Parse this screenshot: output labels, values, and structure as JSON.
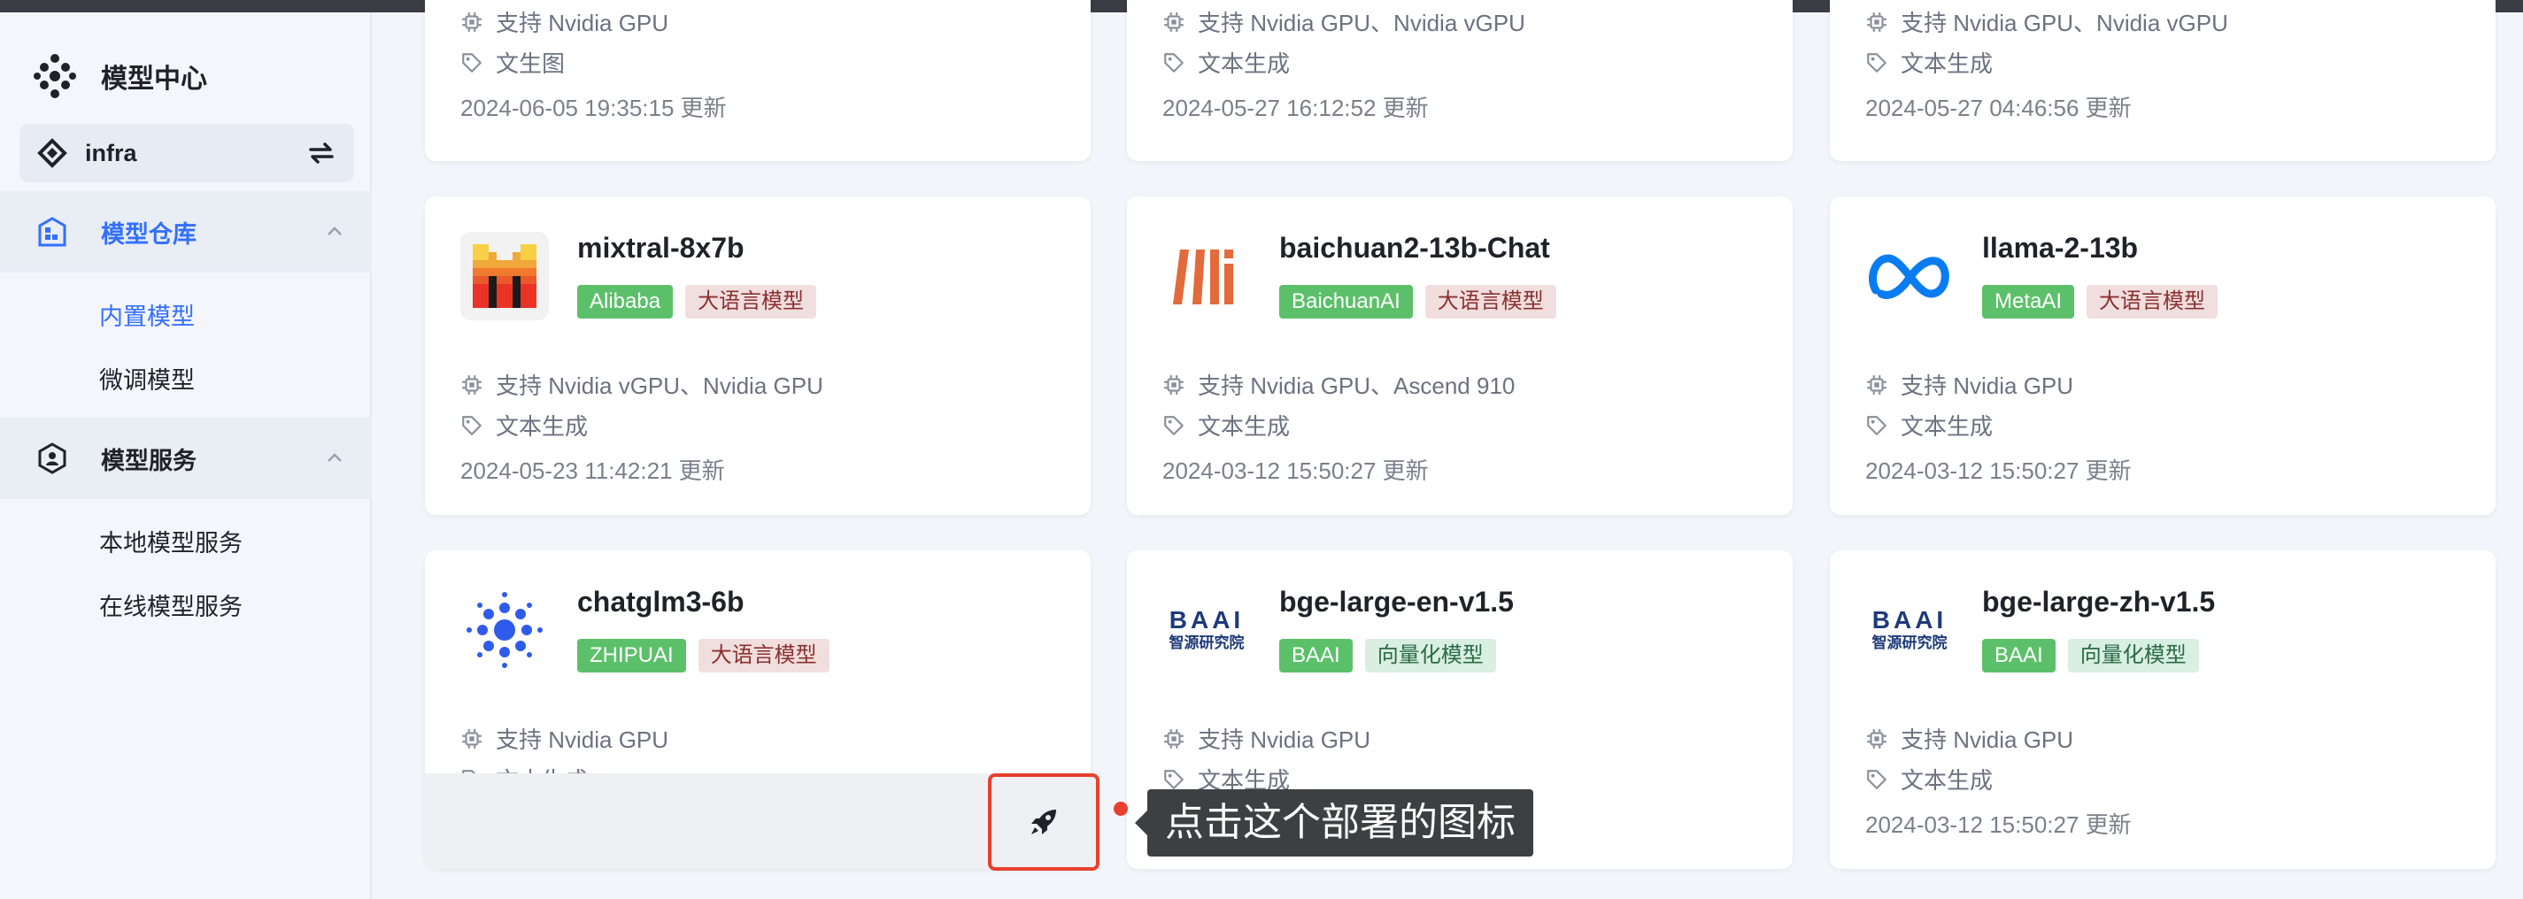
{
  "app": {
    "title": "模型中心"
  },
  "workspace": {
    "name": "infra"
  },
  "nav": {
    "repo": {
      "label": "模型仓库",
      "items": [
        "内置模型",
        "微调模型"
      ]
    },
    "service": {
      "label": "模型服务",
      "items": [
        "本地模型服务",
        "在线模型服务"
      ]
    }
  },
  "cards": [
    {
      "support": "支持 Nvidia GPU",
      "task": "文生图",
      "updated": "2024-06-05 19:35:15 更新"
    },
    {
      "support": "支持 Nvidia GPU、Nvidia vGPU",
      "task": "文本生成",
      "updated": "2024-05-27 16:12:52 更新"
    },
    {
      "support": "支持 Nvidia GPU、Nvidia vGPU",
      "task": "文本生成",
      "updated": "2024-05-27 04:46:56 更新"
    },
    {
      "name": "mixtral-8x7b",
      "vendor": "Alibaba",
      "type": "大语言模型",
      "support": "支持 Nvidia vGPU、Nvidia GPU",
      "task": "文本生成",
      "updated": "2024-05-23 11:42:21 更新",
      "logo": "mistral-logo"
    },
    {
      "name": "baichuan2-13b-Chat",
      "vendor": "BaichuanAI",
      "type": "大语言模型",
      "support": "支持 Nvidia GPU、Ascend 910",
      "task": "文本生成",
      "updated": "2024-03-12 15:50:27 更新",
      "logo": "baichuan-logo"
    },
    {
      "name": "llama-2-13b",
      "vendor": "MetaAI",
      "type": "大语言模型",
      "support": "支持 Nvidia GPU",
      "task": "文本生成",
      "updated": "2024-03-12 15:50:27 更新",
      "logo": "meta-logo"
    },
    {
      "name": "chatglm3-6b",
      "vendor": "ZHIPUAI",
      "type": "大语言模型",
      "support": "支持 Nvidia GPU",
      "task": "文本生成",
      "logo": "zhipu-logo"
    },
    {
      "name": "bge-large-en-v1.5",
      "vendor": "BAAI",
      "type": "向量化模型",
      "support": "支持 Nvidia GPU",
      "task": "文本生成",
      "logo": "baai-logo",
      "logo_text_top": "BAAI",
      "logo_text_bottom": "智源研究院"
    },
    {
      "name": "bge-large-zh-v1.5",
      "vendor": "BAAI",
      "type": "向量化模型",
      "support": "支持 Nvidia GPU",
      "task": "文本生成",
      "updated": "2024-03-12 15:50:27 更新",
      "logo": "baai-logo",
      "logo_text_top": "BAAI",
      "logo_text_bottom": "智源研究院"
    }
  ],
  "tooltip": {
    "text": "点击这个部署的图标"
  },
  "colors": {
    "accent": "#3370ff",
    "highlight": "#e8402d",
    "vendor_tag": "#5cc06a"
  }
}
